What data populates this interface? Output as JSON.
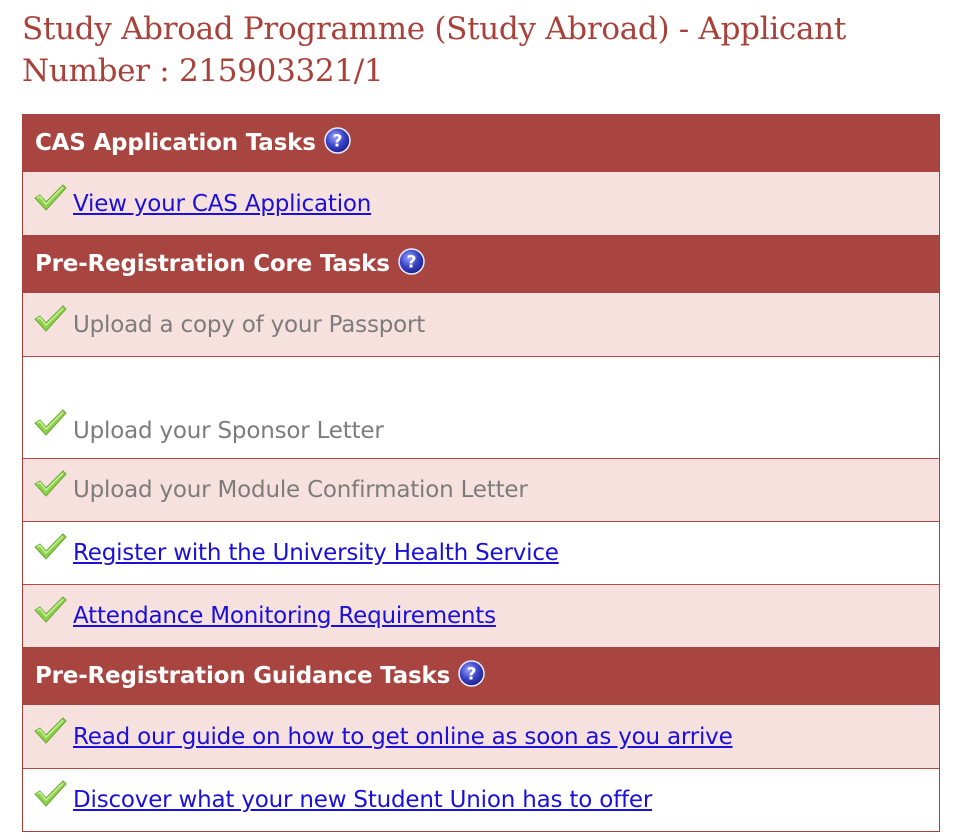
{
  "page": {
    "title": "Study Abroad Programme (Study Abroad) - Applicant Number : 215903321/1"
  },
  "colors": {
    "title": "#a8413a",
    "section_header_bg": "#a94540",
    "row_pink_bg": "#f7e1de",
    "link": "#1a10d8",
    "completed_text": "#7c7c7c",
    "check": "#8fd14f"
  },
  "sections": [
    {
      "heading": "CAS Application Tasks",
      "help_icon": "help-question-icon",
      "tasks": [
        {
          "label": "View your CAS Application",
          "type": "link",
          "icon": "checkmark-icon"
        }
      ]
    },
    {
      "heading": "Pre-Registration Core Tasks",
      "help_icon": "help-question-icon",
      "tasks": [
        {
          "label": "Upload a copy of your Passport",
          "type": "text",
          "icon": "checkmark-icon"
        },
        {
          "label": "Upload your Sponsor Letter",
          "type": "text",
          "icon": "checkmark-icon"
        },
        {
          "label": "Upload your Module Confirmation Letter",
          "type": "text",
          "icon": "checkmark-icon"
        },
        {
          "label": "Register with the University Health Service",
          "type": "link",
          "icon": "checkmark-icon"
        },
        {
          "label": "Attendance Monitoring Requirements",
          "type": "link",
          "icon": "checkmark-icon"
        }
      ]
    },
    {
      "heading": "Pre-Registration Guidance Tasks",
      "help_icon": "help-question-icon",
      "tasks": [
        {
          "label": "Read our guide on how to get online as soon as you arrive",
          "type": "link",
          "icon": "checkmark-icon"
        },
        {
          "label": "Discover what your new Student Union has to offer",
          "type": "link",
          "icon": "checkmark-icon"
        }
      ]
    }
  ]
}
